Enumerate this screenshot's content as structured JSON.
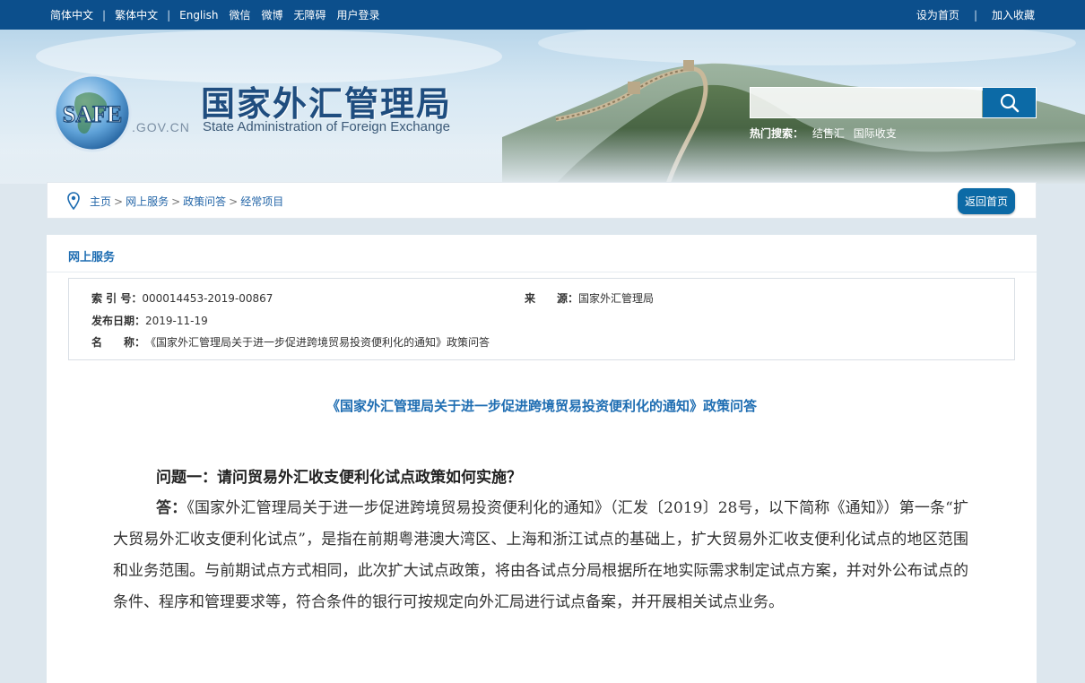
{
  "topbar": {
    "lang_simplified": "简体中文",
    "lang_traditional": "繁体中文",
    "lang_english": "English",
    "wechat": "微信",
    "weibo": "微博",
    "accessibility": "无障碍",
    "login": "用户登录",
    "set_homepage": "设为首页",
    "add_favorite": "加入收藏"
  },
  "header": {
    "logo_text": "SAFE",
    "logo_domain": ".GOV.CN",
    "site_name_cn": "国家外汇管理局",
    "site_name_en": "State Administration of Foreign Exchange",
    "search_placeholder": "",
    "hot_search_label": "热门搜索：",
    "hot_search_items": [
      "结售汇",
      "国际收支"
    ]
  },
  "breadcrumb": {
    "items": [
      "主页",
      "网上服务",
      "政策问答",
      "经常项目"
    ],
    "separator": ">",
    "back_button": "返回首页"
  },
  "main": {
    "section_title": "网上服务",
    "meta": {
      "index_label": "索 引 号：",
      "index_value": "000014453-2019-00867",
      "source_label": "来　　源：",
      "source_value": "国家外汇管理局",
      "date_label": "发布日期：",
      "date_value": "2019-11-19",
      "name_label": "名　　称：",
      "name_value": "《国家外汇管理局关于进一步促进跨境贸易投资便利化的通知》政策问答"
    },
    "article_title": "《国家外汇管理局关于进一步促进跨境贸易投资便利化的通知》政策问答",
    "question": "问题一：请问贸易外汇收支便利化试点政策如何实施？",
    "answer_label": "答：",
    "answer_text": "《国家外汇管理局关于进一步促进跨境贸易投资便利化的通知》（汇发〔2019〕28号，以下简称《通知》）第一条“扩大贸易外汇收支便利化试点”，是指在前期粤港澳大湾区、上海和浙江试点的基础上，扩大贸易外汇收支便利化试点的地区范围和业务范围。与前期试点方式相同，此次扩大试点政策，将由各试点分局根据所在地实际需求制定试点方案，并对外公布试点的条件、程序和管理要求等，符合条件的银行可按规定向外汇局进行试点备案，并开展相关试点业务。"
  },
  "colors": {
    "topbar": "#0c4f8c",
    "accent": "#1e6db2",
    "button": "#0c6aa6"
  }
}
